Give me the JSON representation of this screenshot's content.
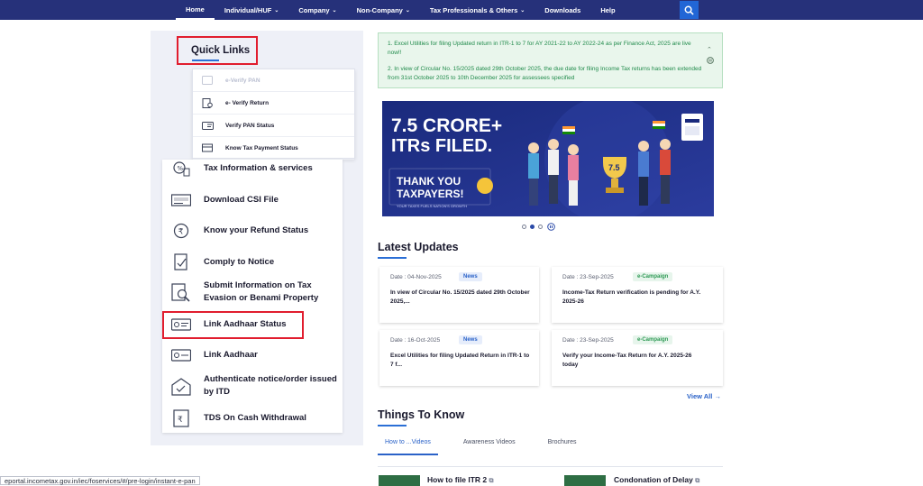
{
  "nav": {
    "items": [
      {
        "label": "Home",
        "active": true,
        "dropdown": false
      },
      {
        "label": "Individual/HUF",
        "active": false,
        "dropdown": true
      },
      {
        "label": "Company",
        "active": false,
        "dropdown": true
      },
      {
        "label": "Non-Company",
        "active": false,
        "dropdown": true
      },
      {
        "label": "Tax Professionals & Others",
        "active": false,
        "dropdown": true
      },
      {
        "label": "Downloads",
        "active": false,
        "dropdown": false
      },
      {
        "label": "Help",
        "active": false,
        "dropdown": false
      }
    ],
    "search_icon": "search-icon"
  },
  "quick_links": {
    "title": "Quick Links",
    "dropdown": [
      {
        "label": "e-Verify PAN",
        "icon": "e-pan-icon"
      },
      {
        "label": "e- Verify Return",
        "icon": "verify-return-icon"
      },
      {
        "label": "Verify PAN Status",
        "icon": "pan-card-icon"
      },
      {
        "label": "Know Tax Payment Status",
        "icon": "payment-icon"
      }
    ],
    "services": [
      {
        "label": "Tax Information & services",
        "icon": "tax-info-icon"
      },
      {
        "label": "Download CSI File",
        "icon": "csi-file-icon"
      },
      {
        "label": "Know your Refund Status",
        "icon": "refund-icon"
      },
      {
        "label": "Comply to Notice",
        "icon": "notice-icon"
      },
      {
        "label": "Submit Information on Tax Evasion or Benami Property",
        "icon": "magnifier-doc-icon"
      },
      {
        "label": "Link Aadhaar Status",
        "icon": "aadhaar-card-icon"
      },
      {
        "label": "Link Aadhaar",
        "icon": "link-aadhaar-icon"
      },
      {
        "label": "Authenticate notice/order issued by ITD",
        "icon": "authenticate-icon"
      },
      {
        "label": "TDS On Cash Withdrawal",
        "icon": "cash-withdrawal-icon"
      }
    ]
  },
  "notice": {
    "line1": "1. Excel Utilities for filing Updated return in ITR-1 to 7 for AY 2021-22 to AY 2022-24 as per Finance Act, 2025 are live now!!",
    "line2": "2. In view of Circular No. 15/2025 dated 29th October 2025, the due date for filing Income Tax returns has been extended from 31st October 2025 to 10th December 2025 for assessees specified"
  },
  "banner": {
    "headline1": "7.5 CRORE+",
    "headline2": "ITRs FILED.",
    "thanks1": "THANK YOU",
    "thanks2": "TAXPAYERS!",
    "tagline": "YOUR TAXES FUELS NATION'S GROWTH",
    "trophy_label": "7.5"
  },
  "carousel": {
    "dots": 3,
    "active": 1
  },
  "latest_updates": {
    "title": "Latest Updates",
    "items": [
      {
        "date": "Date : 04-Nov-2025",
        "badge": "News",
        "badge_color": "blue",
        "text": "In view of Circular No. 15/2025 dated 29th October 2025,..."
      },
      {
        "date": "Date : 23-Sep-2025",
        "badge": "e-Campaign",
        "badge_color": "green",
        "text": "Income-Tax Return verification is pending for A.Y. 2025-26"
      },
      {
        "date": "Date : 16-Oct-2025",
        "badge": "News",
        "badge_color": "blue",
        "text": "Excel Utilities for filing Updated Return in ITR-1 to 7 f..."
      },
      {
        "date": "Date : 23-Sep-2025",
        "badge": "e-Campaign",
        "badge_color": "green",
        "text": "Verify your Income-Tax Return for A.Y. 2025-26 today"
      }
    ],
    "view_all": "View All"
  },
  "things_to_know": {
    "title": "Things To Know",
    "tabs": [
      {
        "label": "How to ...Videos",
        "active": true
      },
      {
        "label": "Awareness Videos",
        "active": false
      },
      {
        "label": "Brochures",
        "active": false
      }
    ],
    "videos": [
      "How to file ITR 2",
      "Condonation of Delay"
    ]
  },
  "status_url": "eportal.incometax.gov.in/iec/foservices/#/pre-login/instant-e-pan",
  "colors": {
    "nav": "#26317a",
    "accent": "#2b6fd6",
    "highlight": "#e11d2e",
    "notice_bg": "#e9f6ec",
    "notice_text": "#1f8a4a"
  }
}
